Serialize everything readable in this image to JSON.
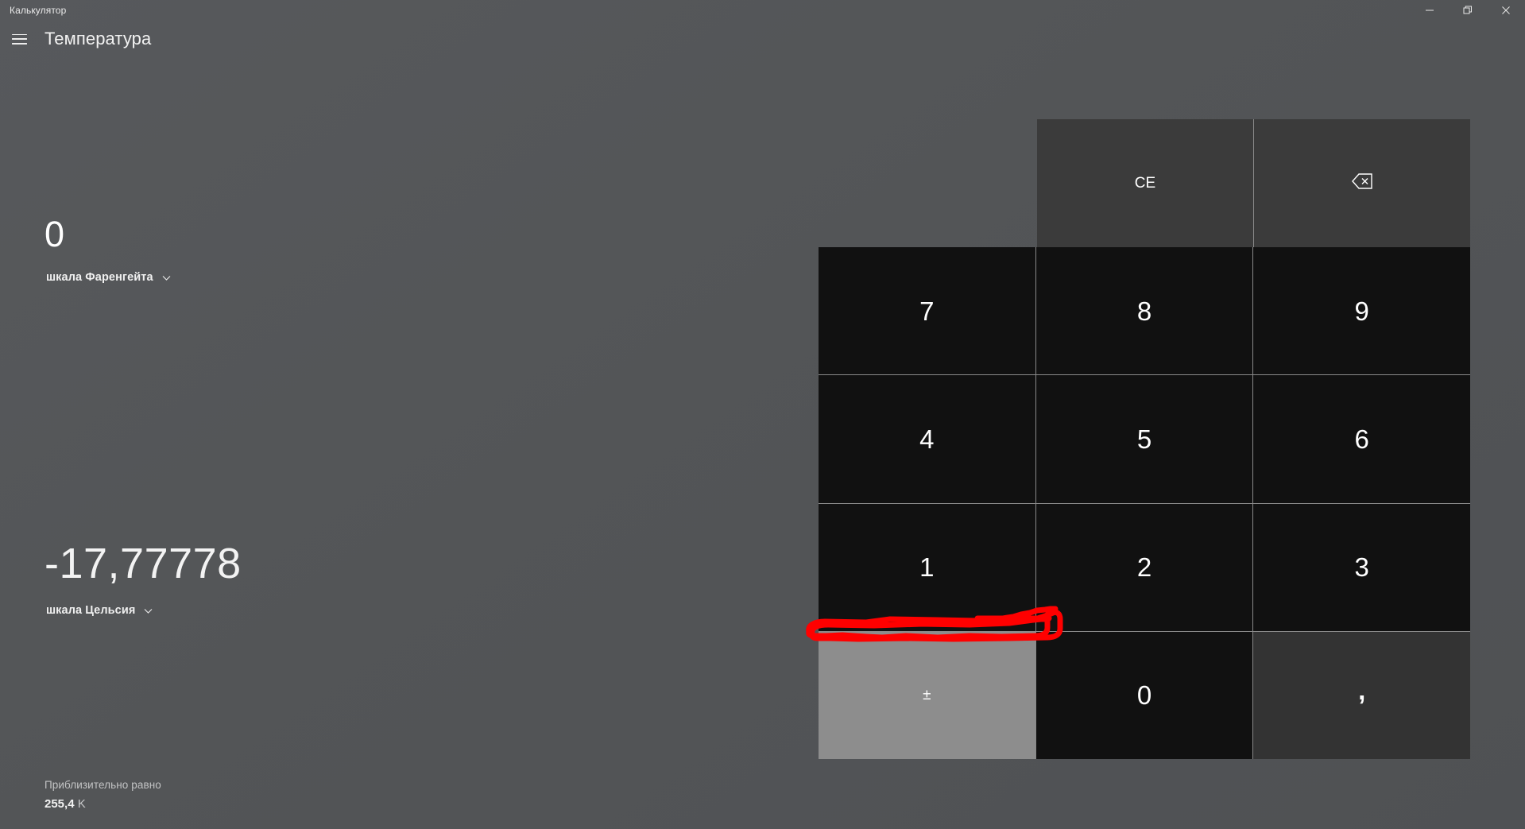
{
  "window": {
    "caption": "Калькулятор",
    "controls": [
      {
        "name": "minimize",
        "label": "Свернуть"
      },
      {
        "name": "restore",
        "label": "Восстановить"
      },
      {
        "name": "close",
        "label": "Закрыть"
      }
    ]
  },
  "header": {
    "menu_icon": "hamburger-icon",
    "title": "Температура"
  },
  "converter": {
    "from": {
      "value": "0",
      "unit_label": "шкала Фаренгейта",
      "chevron_icon": "chevron-down-icon"
    },
    "to": {
      "value": "-17,77778",
      "unit_label": "шкала Цельсия",
      "chevron_icon": "chevron-down-icon"
    },
    "approx": {
      "label": "Приблизительно равно",
      "value": "255,4",
      "unit": "K"
    }
  },
  "keypad": {
    "top_row": [
      {
        "id": "clear-entry",
        "label": "CE",
        "kind": "func",
        "icon": ""
      },
      {
        "id": "backspace",
        "label": "",
        "kind": "func",
        "icon": "backspace-icon"
      }
    ],
    "keys": [
      {
        "id": "digit-7",
        "label": "7",
        "kind": "digit",
        "state": "normal"
      },
      {
        "id": "digit-8",
        "label": "8",
        "kind": "digit",
        "state": "normal"
      },
      {
        "id": "digit-9",
        "label": "9",
        "kind": "digit",
        "state": "normal"
      },
      {
        "id": "digit-4",
        "label": "4",
        "kind": "digit",
        "state": "normal"
      },
      {
        "id": "digit-5",
        "label": "5",
        "kind": "digit",
        "state": "normal"
      },
      {
        "id": "digit-6",
        "label": "6",
        "kind": "digit",
        "state": "normal"
      },
      {
        "id": "digit-1",
        "label": "1",
        "kind": "digit",
        "state": "normal"
      },
      {
        "id": "digit-2",
        "label": "2",
        "kind": "digit",
        "state": "normal"
      },
      {
        "id": "digit-3",
        "label": "3",
        "kind": "digit",
        "state": "normal"
      },
      {
        "id": "sign-toggle",
        "label": "±",
        "kind": "op",
        "state": "hovered"
      },
      {
        "id": "digit-0",
        "label": "0",
        "kind": "digit",
        "state": "normal"
      },
      {
        "id": "decimal",
        "label": ",",
        "kind": "op",
        "state": "normal"
      }
    ]
  },
  "annotation": {
    "type": "freehand-ellipse",
    "color": "#FF0000",
    "describes": "boundary between the 1 key and the plus-minus key"
  },
  "colors": {
    "background": "#545659",
    "func_key": "#3B3B3B",
    "digit_key": "#111111",
    "op_key": "#333333",
    "hover_key": "#8D8D8D",
    "annotation_red": "#FF0000"
  }
}
